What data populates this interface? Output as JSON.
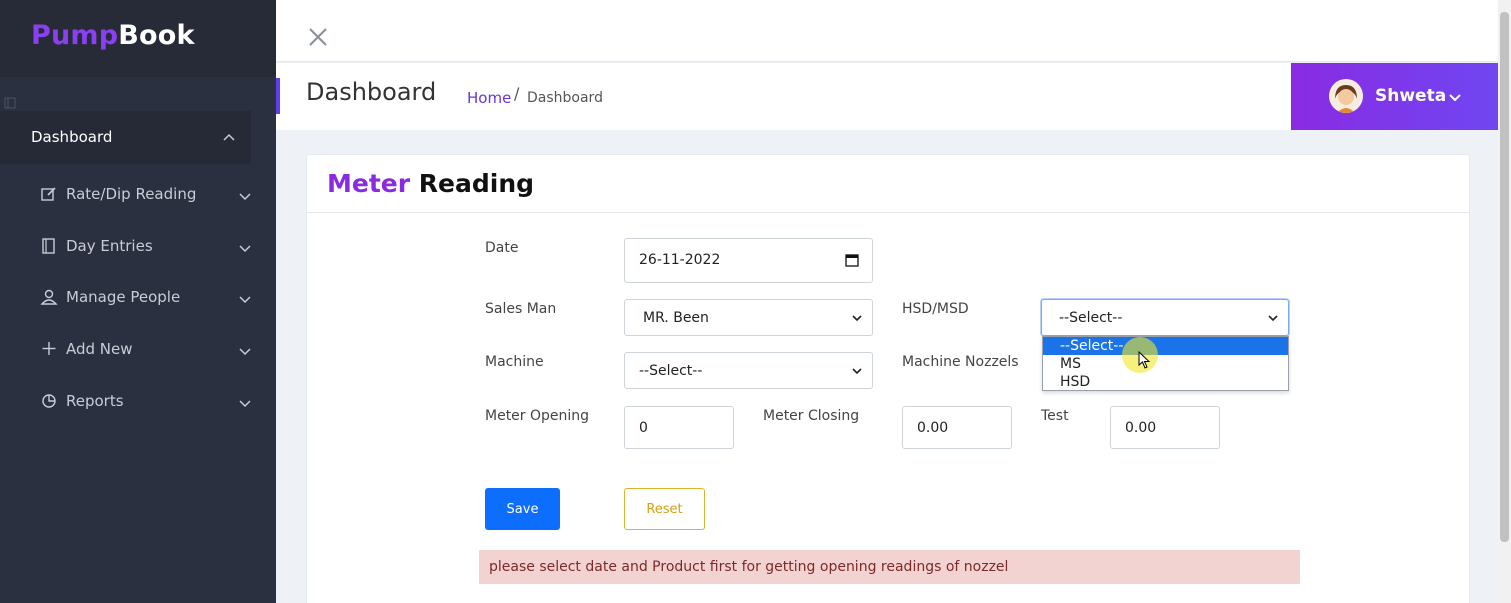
{
  "brand": {
    "part1": "Pump",
    "part2": "Book"
  },
  "sidebar": {
    "active": {
      "label": "Dashboard"
    },
    "items": [
      {
        "label": "Rate/Dip Reading",
        "icon": "edit-icon"
      },
      {
        "label": "Day Entries",
        "icon": "book-icon"
      },
      {
        "label": "Manage People",
        "icon": "person-icon"
      },
      {
        "label": "Add New",
        "icon": "plus-icon"
      },
      {
        "label": "Reports",
        "icon": "pie-chart-icon"
      }
    ]
  },
  "header": {
    "title": "Dashboard",
    "breadcrumb": {
      "home": "Home",
      "separator": "/",
      "current": "Dashboard"
    },
    "user": {
      "name": "Shweta"
    }
  },
  "card": {
    "title_part1": "Meter",
    "title_part2": "Reading"
  },
  "form": {
    "date": {
      "label": "Date",
      "value": "26-11-2022"
    },
    "salesman": {
      "label": "Sales Man",
      "value": "MR. Been"
    },
    "product": {
      "label": "HSD/MSD",
      "value": "--Select--",
      "options": [
        "--Select--",
        "MS",
        "HSD"
      ]
    },
    "machine": {
      "label": "Machine",
      "value": "--Select--"
    },
    "nozzle": {
      "label": "Machine Nozzels"
    },
    "meter_opening": {
      "label": "Meter Opening",
      "value": "0"
    },
    "meter_closing": {
      "label": "Meter Closing",
      "value": "0.00"
    },
    "test": {
      "label": "Test",
      "value": "0.00"
    },
    "save_label": "Save",
    "reset_label": "Reset"
  },
  "alert": {
    "text": "please select date and Product first for getting opening readings of nozzel"
  },
  "colors": {
    "brand_purple": "#8a2be2",
    "sidebar_bg": "#2b3040",
    "primary": "#0d6efd",
    "warning": "#d79f12"
  }
}
